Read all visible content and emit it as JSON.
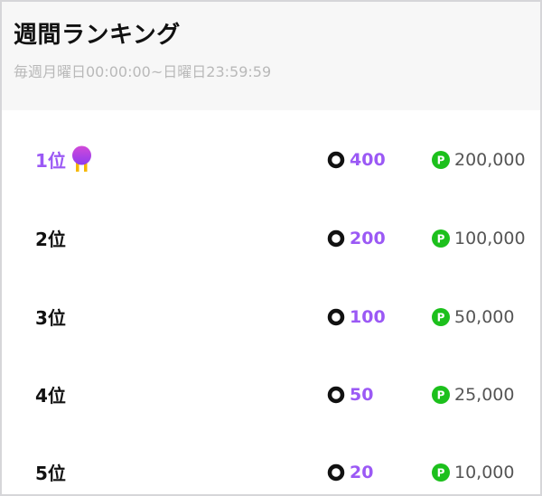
{
  "header": {
    "title": "週間ランキング",
    "period": "毎週月曜日00:00:00~日曜日23:59:59"
  },
  "rankings": [
    {
      "rank": "1位",
      "points": "400",
      "prize": "200,000",
      "medal": true
    },
    {
      "rank": "2位",
      "points": "200",
      "prize": "100,000",
      "medal": false
    },
    {
      "rank": "3位",
      "points": "100",
      "prize": "50,000",
      "medal": false
    },
    {
      "rank": "4位",
      "points": "50",
      "prize": "25,000",
      "medal": false
    },
    {
      "rank": "5位",
      "points": "20",
      "prize": "10,000",
      "medal": false
    }
  ],
  "colors": {
    "accent": "#9b59f5",
    "prize_icon": "#1cc01c",
    "header_bg": "#f7f7f7"
  },
  "icons": {
    "medal": "medal-icon",
    "points": "coin-icon",
    "prize": "point-p-icon"
  }
}
